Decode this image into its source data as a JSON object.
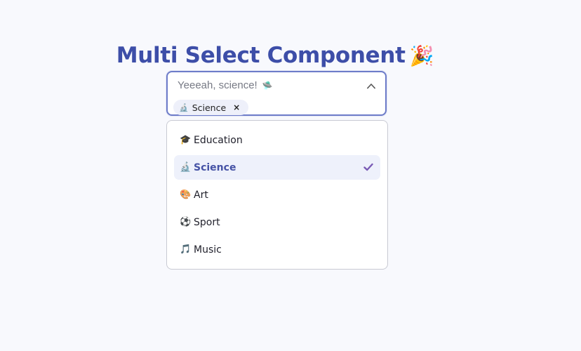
{
  "page": {
    "title": "Multi Select Component",
    "title_icon": "🎉"
  },
  "select": {
    "placeholder": "Yeeeah, science!",
    "placeholder_icon": "🛸",
    "chevron_icon": "chevron-up-icon",
    "chips": [
      {
        "icon": "🔬",
        "label": "Science",
        "remove": "×"
      }
    ]
  },
  "options": [
    {
      "icon": "🎓",
      "label": "Education",
      "selected": false
    },
    {
      "icon": "🔬",
      "label": "Science",
      "selected": true
    },
    {
      "icon": "🎨",
      "label": "Art",
      "selected": false
    },
    {
      "icon": "⚽",
      "label": "Sport",
      "selected": false
    },
    {
      "icon": "🎵",
      "label": "Music",
      "selected": false
    }
  ],
  "colors": {
    "background": "#f8f9fd",
    "title": "#3d4ea8",
    "accent": "#6d7cc9",
    "selected_bg": "#eef1fb",
    "check": "#7a5bb5"
  }
}
